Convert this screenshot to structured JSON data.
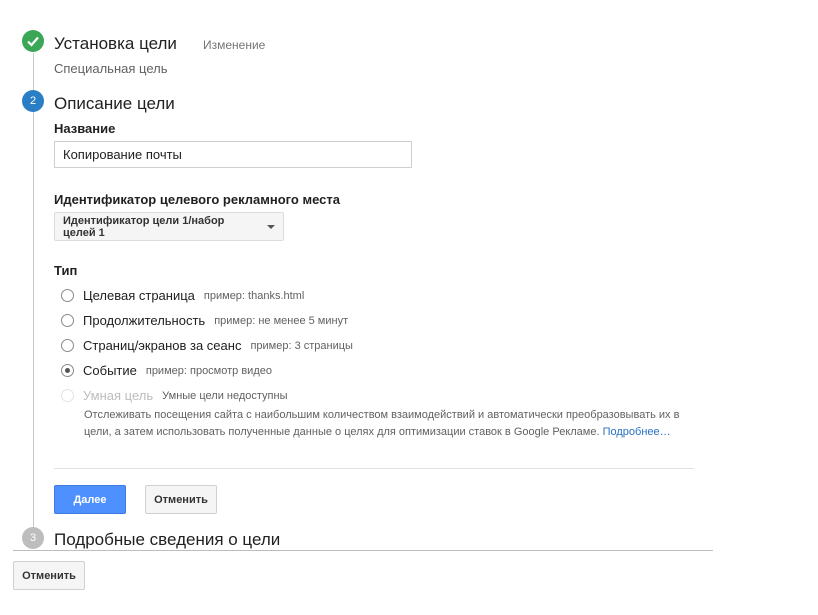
{
  "step1": {
    "title": "Установка цели",
    "edit_label": "Изменение",
    "subtitle": "Специальная цель"
  },
  "step2": {
    "number": "2",
    "title": "Описание цели",
    "name_label": "Название",
    "name_value": "Копирование почты",
    "slot_label": "Идентификатор целевого рекламного места",
    "slot_value": "Идентификатор цели 1/набор целей 1",
    "type_label": "Тип",
    "types": [
      {
        "label": "Целевая страница",
        "example": "пример: thanks.html",
        "checked": false,
        "disabled": false
      },
      {
        "label": "Продолжительность",
        "example": "пример: не менее 5 минут",
        "checked": false,
        "disabled": false
      },
      {
        "label": "Страниц/экранов за сеанс",
        "example": "пример: 3 страницы",
        "checked": false,
        "disabled": false
      },
      {
        "label": "Событие",
        "example": "пример: просмотр видео",
        "checked": true,
        "disabled": false
      },
      {
        "label": "Умная цель",
        "example": "Умные цели недоступны",
        "checked": false,
        "disabled": true
      }
    ],
    "smart_description": "Отслеживать посещения сайта с наибольшим количеством взаимодействий и автоматически преобразовывать их в цели, а затем использовать полученные данные о целях для оптимизации ставок в Google Рекламе.",
    "smart_more_link": "Подробнее…",
    "next_button": "Далее",
    "cancel_button": "Отменить"
  },
  "step3": {
    "number": "3",
    "title": "Подробные сведения о цели"
  },
  "bottom": {
    "cancel_button": "Отменить"
  }
}
